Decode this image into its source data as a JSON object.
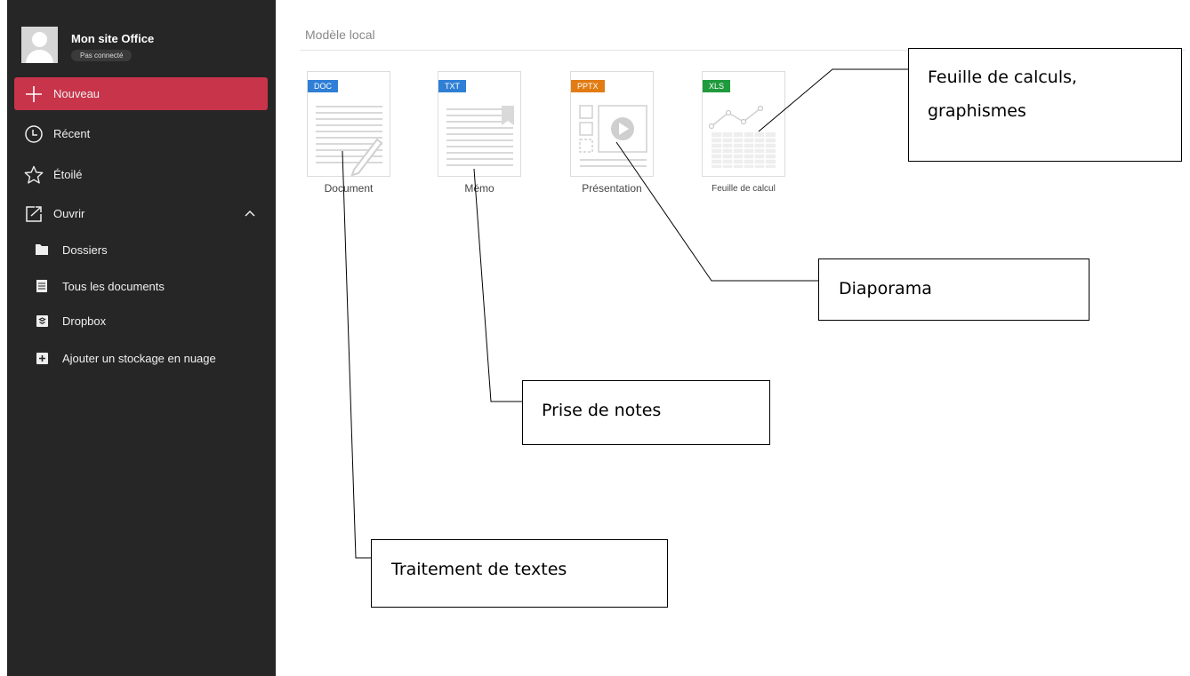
{
  "account": {
    "name": "Mon site Office",
    "status": "Pas connecté"
  },
  "nav": {
    "new_label": "Nouveau",
    "recent_label": "Récent",
    "starred_label": "Étoilé",
    "open_label": "Ouvrir"
  },
  "open_items": [
    {
      "label": "Dossiers",
      "icon": "folder-icon"
    },
    {
      "label": "Tous les documents",
      "icon": "documents-icon"
    },
    {
      "label": "Dropbox",
      "icon": "dropbox-icon"
    },
    {
      "label": "Ajouter un stockage en nuage",
      "icon": "add-cloud-icon"
    }
  ],
  "section_title": "Modèle local",
  "templates": [
    {
      "badge": "DOC",
      "label": "Document",
      "badge_color": "#2f7fd6"
    },
    {
      "badge": "TXT",
      "label": "Mémo",
      "badge_color": "#2f7fd6"
    },
    {
      "badge": "PPTX",
      "label": "Présentation",
      "badge_color": "#e17b12"
    },
    {
      "badge": "XLS",
      "label": "Feuille de calcul",
      "badge_color": "#1f9a3c"
    }
  ],
  "callouts": {
    "spreadsheet": [
      "Feuille de calculs,",
      "graphismes"
    ],
    "slideshow": "Diaporama",
    "notes": "Prise de notes",
    "word_processing": "Traitement de textes"
  },
  "colors": {
    "sidebar_bg": "#262626",
    "active_item": "#c8344a"
  }
}
